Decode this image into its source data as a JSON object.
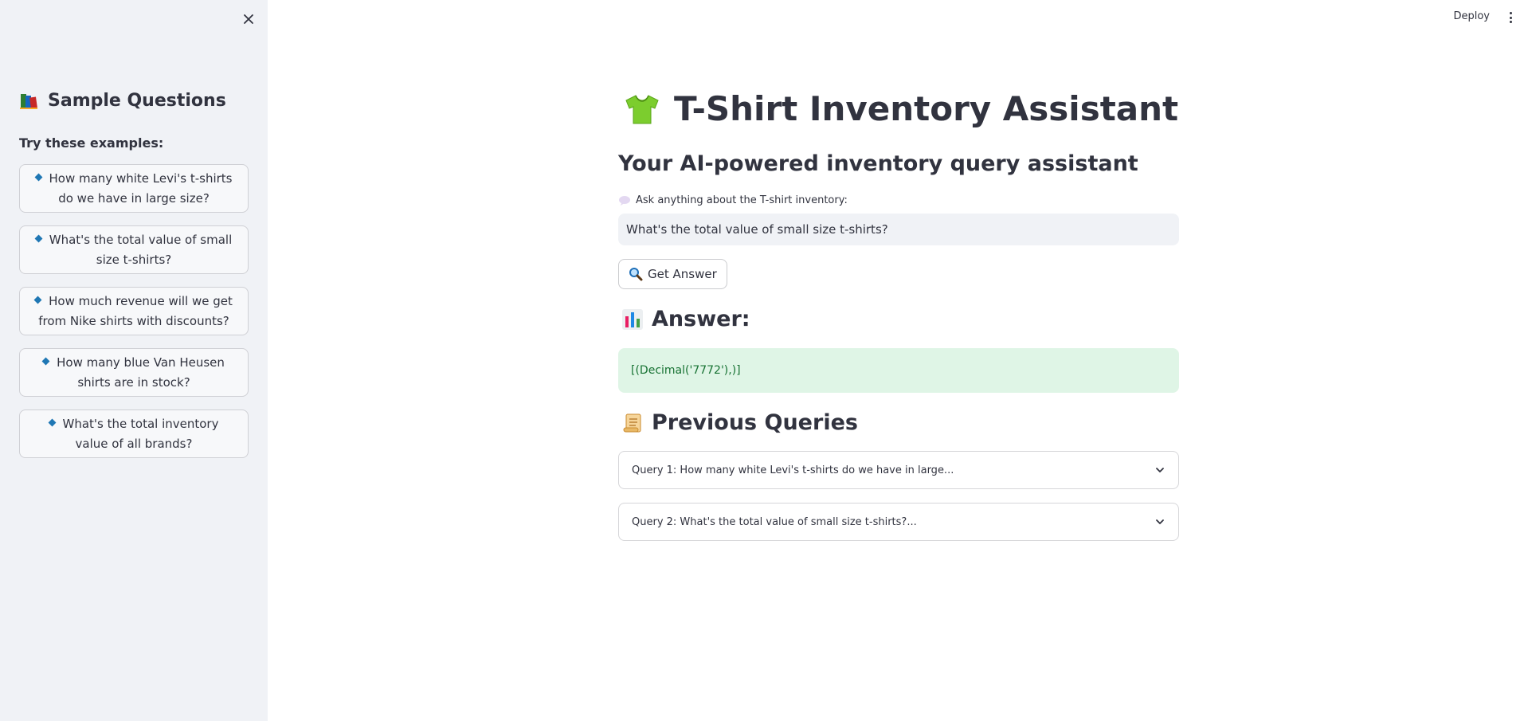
{
  "sidebar": {
    "title": "Sample Questions",
    "subtitle": "Try these examples:",
    "questions": [
      "How many white Levi's t-shirts do we have in large size?",
      "What's the total value of small size t-shirts?",
      "How much revenue will we get from Nike shirts with discounts?",
      "How many blue Van Heusen shirts are in stock?",
      "What's the total inventory value of all brands?"
    ]
  },
  "header": {
    "deploy_label": "Deploy"
  },
  "main": {
    "title": "T-Shirt Inventory Assistant",
    "subtitle": "Your AI-powered inventory query assistant",
    "input_label": "Ask anything about the T-shirt inventory:",
    "input_value": "What's the total value of small size t-shirts?",
    "button_label": "Get Answer",
    "answer_heading": "Answer:",
    "answer_text": "[(Decimal('7772'),)]",
    "previous_heading": "Previous Queries",
    "previous_queries": [
      "Query 1: How many white Levi's t-shirts do we have in large...",
      "Query 2: What's the total value of small size t-shirts?..."
    ]
  },
  "colors": {
    "sidebar_bg": "#f0f2f6",
    "answer_bg": "#dff5e6",
    "answer_text": "#177233",
    "bullet": "#1f77b4"
  },
  "icons": {
    "sidebar_title": "books-icon",
    "page_title": "tshirt-icon",
    "input_label": "speech-bubble-icon",
    "button": "magnifier-icon",
    "answer": "bar-chart-icon",
    "previous": "scroll-icon"
  }
}
